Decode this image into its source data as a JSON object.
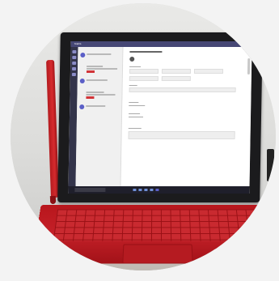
{
  "image": {
    "screen": {
      "app_title": "Teams"
    },
    "colors": {
      "teams_purple": "#464775",
      "accent_red": "#d13438",
      "keyboard_red": "#c42028"
    }
  }
}
